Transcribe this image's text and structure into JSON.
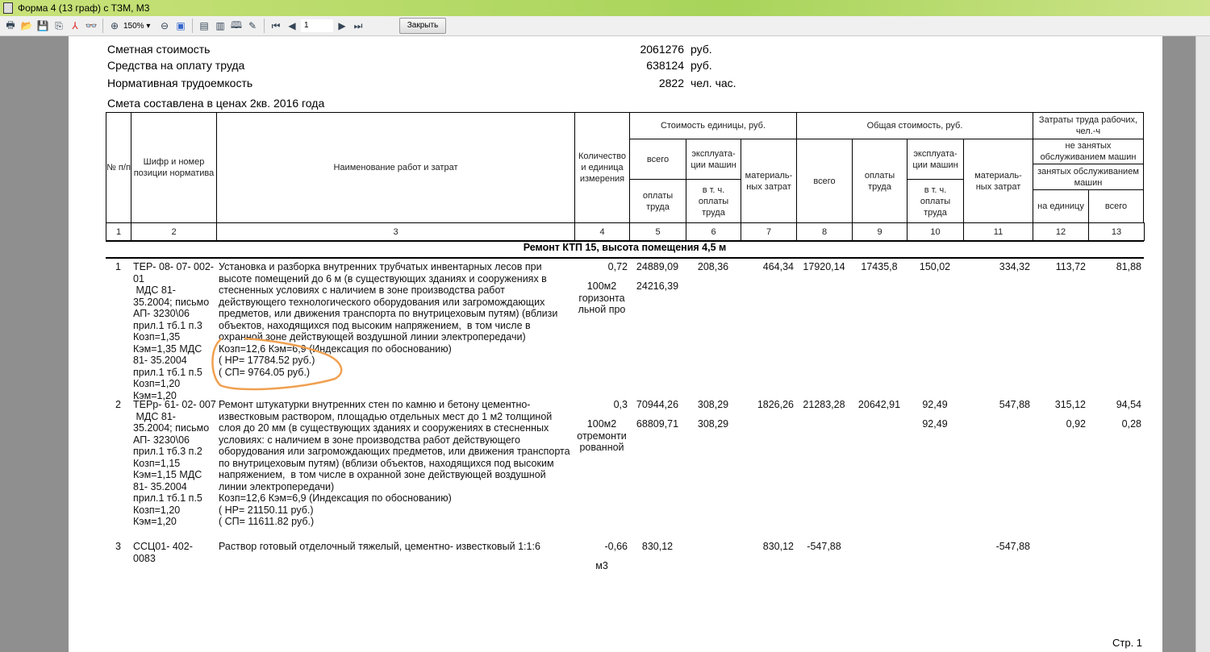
{
  "window": {
    "title": "Форма 4 (13 граф) с ТЗМ, М3"
  },
  "toolbar": {
    "zoom": "150%",
    "page": "1",
    "close_label": "Закрыть"
  },
  "summary": [
    {
      "label": "Сметная стоимость",
      "value": "2061276",
      "unit": "руб."
    },
    {
      "label": "Средства на оплату труда",
      "value": "638124",
      "unit": "руб."
    },
    {
      "label": "Нормативная трудоемкость",
      "value": "2822",
      "unit": "чел. час."
    }
  ],
  "prices_note": "Смета составлена в ценах 2кв. 2016 года",
  "headers": {
    "num": "№ п/п",
    "code": "Шифр и номер позиции норматива",
    "name": "Наименование работ и затрат",
    "qty": "Количество и единица измерения",
    "unit_cost": "Стоимость единицы, руб.",
    "total_cost": "Общая стоимость, руб.",
    "labor": "Затраты труда рабочих, чел.-ч",
    "all": "всего",
    "wages": "оплаты труда",
    "machines": "эксплуата-ции машин",
    "incl_wages": "в т. ч. оплаты труда",
    "materials": "материаль-ных затрат",
    "not_busy": "не занятых обслуживанием машин",
    "busy": "занятых обслуживанием машин",
    "per_unit": "на единицу",
    "total": "всего",
    "numbers": [
      "1",
      "2",
      "3",
      "4",
      "5",
      "6",
      "7",
      "8",
      "9",
      "10",
      "11",
      "12",
      "13"
    ]
  },
  "section_title": "Ремонт КТП 15, высота помещения 4,5 м",
  "rows": [
    {
      "n": "1",
      "code": "ТЕР- 08- 07- 002- 01\n МДС 81- 35.2004; письмо АП- 3230\\06 прил.1 тб.1 п.3 Козп=1,35 Кэм=1,35 МДС 81- 35.2004 прил.1 тб.1 п.5 Козп=1,20 Кэм=1,20",
      "name": "Установка и разборка внутренних трубчатых инвентарных лесов при высоте помещений до 6 м (в существующих зданиях и сооружениях в стесненных условиях с наличием в зоне производства работ действующего технологического оборудования или загромождающих предметов, или движения транспорта по внутрицеховым путям) (вблизи объектов, находящихся под высоким напряжением,  в том числе в охранной зоне действующей воздушной линии электропередачи)\nКозп=12,6 Кэм=6,9 (Индексация по обоснованию)\n( НР= 17784.52 руб.)\n( СП= 9764.05 руб.)",
      "qty": "0,72",
      "unit": "100м2 горизонта льной про",
      "c5": "24889,09",
      "c5b": "24216,39",
      "c6": "208,36",
      "c6b": "",
      "c7": "464,34",
      "c8": "17920,14",
      "c9": "17435,8",
      "c10": "150,02",
      "c10b": "",
      "c11": "334,32",
      "c12": "113,72",
      "c12b": "",
      "c13": "81,88",
      "c13b": ""
    },
    {
      "n": "2",
      "code": "ТЕРр- 61- 02- 007\n МДС 81- 35.2004; письмо АП- 3230\\06 прил.1 тб.3 п.2 Козп=1,15 Кэм=1,15 МДС 81- 35.2004 прил.1 тб.1 п.5 Козп=1,20 Кэм=1,20",
      "name": "Ремонт штукатурки внутренних стен по камню и бетону цементно-известковым раствором, площадью отдельных мест до 1 м2 толщиной слоя до 20 мм (в существующих зданиях и сооружениях в стесненных условиях: с наличием в зоне производства работ действующего оборудования или загромождающих предметов, или движения транспорта по внутрицеховым путям) (вблизи объектов, находящихся под высоким напряжением,  в том числе в охранной зоне действующей воздушной линии электропередачи)\nКозп=12,6 Кэм=6,9 (Индексация по обоснованию)\n( НР= 21150.11 руб.)\n( СП= 11611.82 руб.)",
      "qty": "0,3",
      "unit": "100м2 отремонти рованной",
      "c5": "70944,26",
      "c5b": "68809,71",
      "c6": "308,29",
      "c6b": "308,29",
      "c7": "1826,26",
      "c8": "21283,28",
      "c9": "20642,91",
      "c10": "92,49",
      "c10b": "92,49",
      "c11": "547,88",
      "c12": "315,12",
      "c12b": "0,92",
      "c13": "94,54",
      "c13b": "0,28"
    },
    {
      "n": "3",
      "code": "ССЦ01- 402- 0083",
      "name": "Раствор готовый отделочный тяжелый, цементно- известковый 1:1:6",
      "qty": "-0,66",
      "unit": "м3",
      "c5": "830,12",
      "c5b": "",
      "c6": "",
      "c6b": "",
      "c7": "830,12",
      "c8": "-547,88",
      "c9": "",
      "c10": "",
      "c10b": "",
      "c11": "-547,88",
      "c12": "",
      "c12b": "",
      "c13": "",
      "c13b": ""
    }
  ],
  "footer": {
    "page_label": "Стр. 1"
  },
  "colors": {
    "annotation": "#f0a050",
    "titlebar": "#b5da68"
  }
}
